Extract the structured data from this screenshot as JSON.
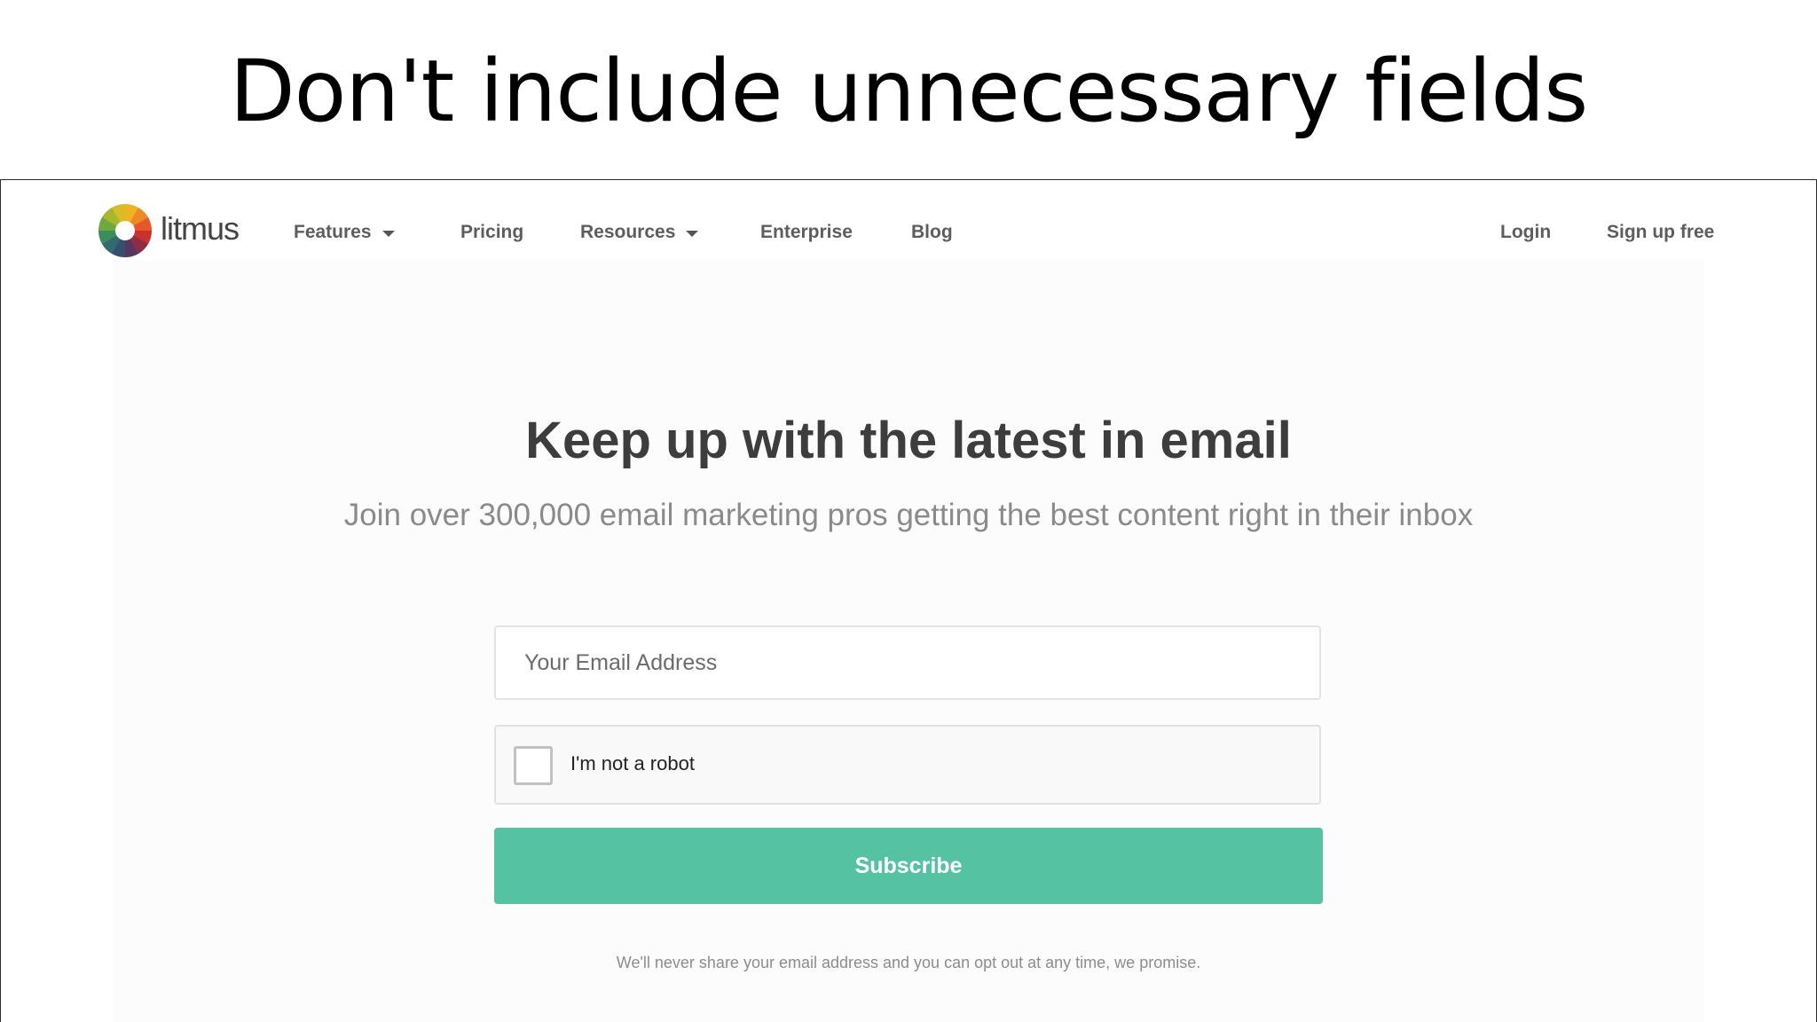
{
  "slide": {
    "title": "Don't include unnecessary fields"
  },
  "nav": {
    "logo_text": "litmus",
    "items": [
      {
        "label": "Features",
        "has_dropdown": true
      },
      {
        "label": "Pricing",
        "has_dropdown": false
      },
      {
        "label": "Resources",
        "has_dropdown": true
      },
      {
        "label": "Enterprise",
        "has_dropdown": false
      },
      {
        "label": "Blog",
        "has_dropdown": false
      }
    ],
    "login_label": "Login",
    "signup_label": "Sign up free"
  },
  "hero": {
    "title": "Keep up with the latest in email",
    "subtitle": "Join over 300,000 email marketing pros getting the best content right in their inbox"
  },
  "form": {
    "email_placeholder": "Your Email Address",
    "email_value": "",
    "captcha_label": "I'm not a robot",
    "captcha_checked": false,
    "subscribe_label": "Subscribe",
    "privacy_note": "We'll never share your email address and you can opt out at any time, we promise."
  },
  "colors": {
    "accent": "#55c2a1",
    "heading": "#3d3d3d",
    "muted_text": "#8a8a8a"
  }
}
